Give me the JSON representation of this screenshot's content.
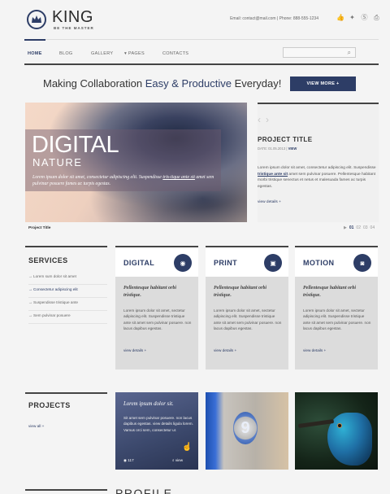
{
  "brand": {
    "name": "KING",
    "tagline": "BE THE MASTER"
  },
  "header": {
    "contact": "Email: contact@mail.com  |  Phone: 888-555-1234"
  },
  "nav": {
    "items": [
      "HOME",
      "BLOG",
      "GALLERY",
      "PAGES",
      "CONTACTS"
    ],
    "active": "HOME"
  },
  "search": {
    "placeholder": ""
  },
  "promo": {
    "text_a": "Making Collaboration ",
    "text_b": "Easy & Productive",
    "text_c": " Everyday!",
    "button": "VIEW MORE +"
  },
  "hero": {
    "title": "DIGITAL",
    "subtitle": "NATURE",
    "text_a": "Lorem ipsum dolor sit amet, consectetur adipiscing elit. Suspendisse ",
    "text_link": "tris-tique ante sit",
    "text_b": " amet sem pulvinar posuere fames ac turpis egestas.",
    "caption": "Project Title",
    "pages": [
      "01",
      "02",
      "03",
      "04"
    ]
  },
  "project_detail": {
    "title": "PROJECT TITLE",
    "date": "DATE: 01.05.2013",
    "separator": "|",
    "meta_link": "VIEW",
    "text_a": "Lorem ipsum dolor sit amet, consectetur adipiscing elit. Suspendisse ",
    "text_link": "tristique ante sit",
    "text_b": " amet sem pulvinar posuere. Pellentesque habitant morbi tristique senectus et netus et malesuada fames ac turpis egestas.",
    "link": "view details +"
  },
  "services": {
    "title": "SERVICES",
    "items": [
      "Lorem sum dolor sit amet",
      "Consectetur adipiscing elit",
      "Suspendisse tristique ante",
      "Sem pulvinar posuere"
    ],
    "active_index": 1
  },
  "cards": [
    {
      "title": "DIGITAL",
      "icon": "eye-icon",
      "glyph": "◉",
      "quote": "Pellentesque habitant orbi tristique.",
      "text": "Lorem ipsum dolor sit amet, sectetur adipiscing elit. Suspendisse tristique ante sit amet sem pulvinar posuere. non lacus dapibus egestas.",
      "link": "view details +"
    },
    {
      "title": "PRINT",
      "icon": "monitor-icon",
      "glyph": "▣",
      "quote": "Pellentesque habitant orbi tristique.",
      "text": "Lorem ipsum dolor sit amet, sectetur adipiscing elit. Suspendisse tristique ante sit amet sem pulvinar posuere. non lacus dapibus egestas.",
      "link": "view details +"
    },
    {
      "title": "MOTION",
      "icon": "camera-icon",
      "glyph": "◙",
      "quote": "Pellentesque habitant orbi tristique.",
      "text": "Lorem ipsum dolor sit amet, sectetur adipiscing elit. Suspendisse tristique ante sit amet sem pulvinar posuere. non lacus dapibus egestas.",
      "link": "view details +"
    }
  ],
  "projects": {
    "title": "PROJECTS",
    "link": "view all +",
    "overlay": {
      "title": "Lorem ipsum dolor sit.",
      "text": "Sit amet sem pulvinar posuere. non lacus dapibus egestas. view details ligula lorem. Vamus orci sem, consectetur ur.",
      "count": "117",
      "view": "view"
    },
    "sign_number": "9"
  },
  "footer_section": {
    "title": "PROFILE"
  },
  "colors": {
    "accent": "#2d3d66",
    "rule": "#444444",
    "background": "#f4f4f4"
  }
}
